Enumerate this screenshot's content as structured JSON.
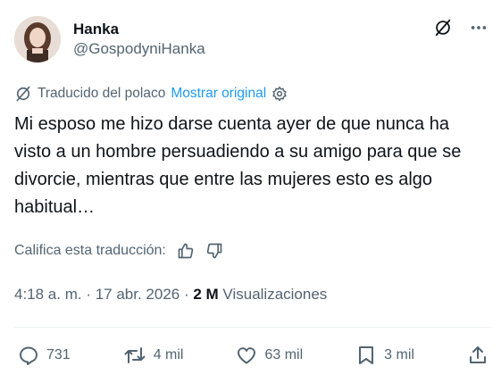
{
  "author": {
    "display_name": "Hanka",
    "handle": "@GospodyniHanka"
  },
  "header_icons": [
    "translate-icon",
    "more-icon"
  ],
  "translation": {
    "label": "Traducido del polaco",
    "show_original": "Mostrar original"
  },
  "tweet": {
    "text": "Mi esposo me hizo darse cuenta ayer de que nunca ha visto a un hombre persuadiendo a su amigo para que se divorcie, mientras que entre las mujeres esto es algo habitual…"
  },
  "rating": {
    "label": "Califica esta traducción:"
  },
  "meta": {
    "time": "4:18 a. m.",
    "sep1": " · ",
    "date": "17 abr. 2026",
    "sep2": " · ",
    "views_count": "2 M",
    "views_label": " Visualizaciones"
  },
  "actions": {
    "replies": "731",
    "reposts": "4 mil",
    "likes": "63 mil",
    "bookmarks": "3 mil"
  },
  "colors": {
    "text": "#0f1419",
    "muted": "#536471",
    "link": "#1d9bf0",
    "divider": "#eff3f4"
  }
}
